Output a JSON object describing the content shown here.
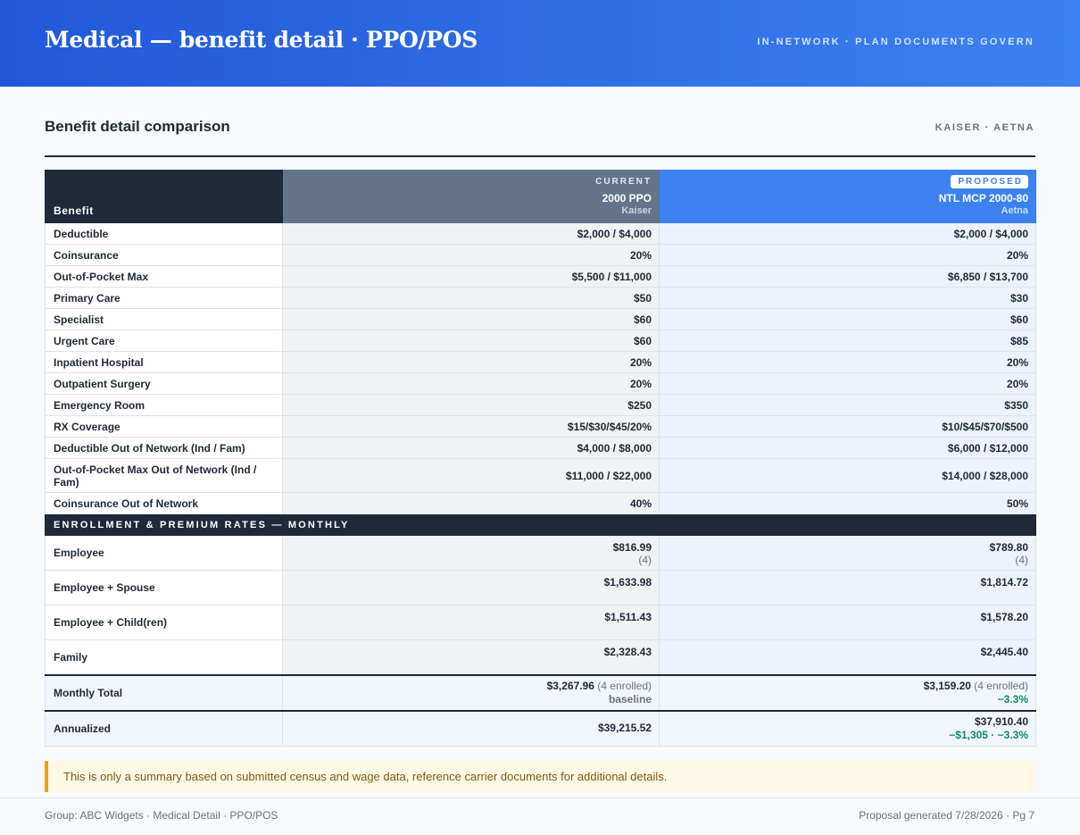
{
  "banner": {
    "title": "Medical — benefit detail · PPO/POS",
    "tagline": "IN-NETWORK · PLAN DOCUMENTS GOVERN"
  },
  "section": {
    "title": "Benefit detail comparison",
    "carriers": "KAISER · AETNA"
  },
  "table": {
    "benefit_header": "Benefit",
    "current": {
      "kicker": "CURRENT",
      "plan": "2000 PPO",
      "carrier": "Kaiser"
    },
    "proposed": {
      "kicker": "PROPOSED",
      "plan": "NTL MCP 2000-80",
      "carrier": "Aetna"
    },
    "rows": [
      {
        "label": "Deductible",
        "current": "$2,000 / $4,000",
        "proposed": "$2,000 / $4,000"
      },
      {
        "label": "Coinsurance",
        "current": "20%",
        "proposed": "20%"
      },
      {
        "label": "Out-of-Pocket Max",
        "current": "$5,500 / $11,000",
        "proposed": "$6,850 / $13,700"
      },
      {
        "label": "Primary Care",
        "current": "$50",
        "proposed": "$30"
      },
      {
        "label": "Specialist",
        "current": "$60",
        "proposed": "$60"
      },
      {
        "label": "Urgent Care",
        "current": "$60",
        "proposed": "$85"
      },
      {
        "label": "Inpatient Hospital",
        "current": "20%",
        "proposed": "20%"
      },
      {
        "label": "Outpatient Surgery",
        "current": "20%",
        "proposed": "20%"
      },
      {
        "label": "Emergency Room",
        "current": "$250",
        "proposed": "$350"
      },
      {
        "label": "RX Coverage",
        "current": "$15/$30/$45/20%",
        "proposed": "$10/$45/$70/$500"
      },
      {
        "label": "Deductible Out of Network (Ind / Fam)",
        "current": "$4,000 / $8,000",
        "proposed": "$6,000 / $12,000"
      },
      {
        "label": "Out-of-Pocket Max Out of Network (Ind / Fam)",
        "current": "$11,000 / $22,000",
        "proposed": "$14,000 / $28,000"
      },
      {
        "label": "Coinsurance Out of Network",
        "current": "40%",
        "proposed": "50%"
      }
    ],
    "rates_band": "ENROLLMENT & PREMIUM RATES — MONTHLY",
    "rates": [
      {
        "label": "Employee",
        "current": "$816.99",
        "current_count": "(4)",
        "proposed": "$789.80",
        "proposed_count": "(4)"
      },
      {
        "label": "Employee + Spouse",
        "current": "$1,633.98",
        "current_count": "",
        "proposed": "$1,814.72",
        "proposed_count": ""
      },
      {
        "label": "Employee + Child(ren)",
        "current": "$1,511.43",
        "current_count": "",
        "proposed": "$1,578.20",
        "proposed_count": ""
      },
      {
        "label": "Family",
        "current": "$2,328.43",
        "current_count": "",
        "proposed": "$2,445.40",
        "proposed_count": ""
      }
    ],
    "monthly_total": {
      "label": "Monthly Total",
      "current": "$3,267.96",
      "current_note": "(4 enrolled)",
      "current_sub": "baseline",
      "proposed": "$3,159.20",
      "proposed_note": "(4 enrolled)",
      "proposed_sub": "−3.3%"
    },
    "annualized": {
      "label": "Annualized",
      "current": "$39,215.52",
      "proposed": "$37,910.40",
      "proposed_sub": "−$1,305 · −3.3%"
    }
  },
  "notice": "This is only a summary based on submitted census and wage data, reference carrier documents for additional details.",
  "footer": {
    "left": "Group: ABC Widgets · Medical Detail · PPO/POS",
    "right": "Proposal generated 7/28/2026 · Pg 7"
  },
  "colors": {
    "banner": "#2f6fe6",
    "dark": "#1f2937",
    "current_header": "#64748b",
    "proposed_header": "#3b82f0",
    "savings_green": "#0f8a5f",
    "notice_accent": "#e3a21a"
  }
}
